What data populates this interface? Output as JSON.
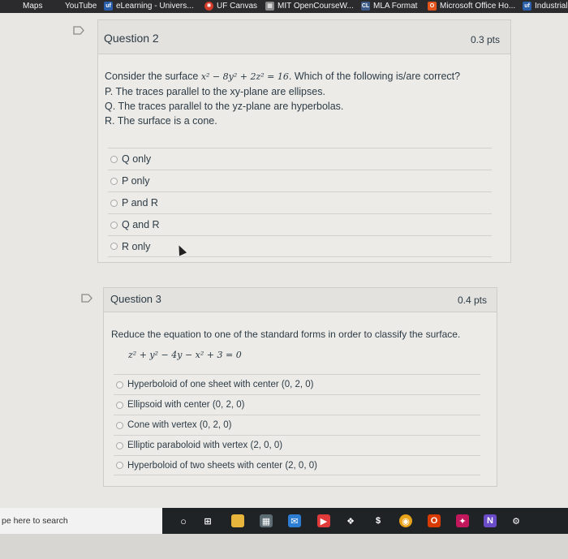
{
  "bookmarks": [
    {
      "label": "Maps",
      "icon": "maps-icon"
    },
    {
      "label": "YouTube",
      "icon": "youtube-icon"
    },
    {
      "label": "eLearning - Univers...",
      "icon": "uf-icon"
    },
    {
      "label": "UF Canvas",
      "icon": "canvas-icon"
    },
    {
      "label": "MIT OpenCourseW...",
      "icon": "mit-icon"
    },
    {
      "label": "MLA Format",
      "icon": "mla-icon"
    },
    {
      "label": "Microsoft Office Ho...",
      "icon": "office-icon"
    },
    {
      "label": "Industrial",
      "icon": "uf-icon"
    }
  ],
  "question2": {
    "title": "Question 2",
    "points": "0.3 pts",
    "prompt_pre": "Consider the surface ",
    "equation": "x² − 8y² + 2z² = 16",
    "prompt_post": ". Which of the following is/are correct?",
    "statements": [
      "P. The traces parallel to the xy-plane are ellipses.",
      "Q. The traces parallel to the yz-plane are hyperbolas.",
      "R. The surface is a cone."
    ],
    "answers": [
      "Q only",
      "P only",
      "P and R",
      "Q and R",
      "R only"
    ]
  },
  "question3": {
    "title": "Question 3",
    "points": "0.4 pts",
    "prompt": "Reduce the equation to one of the standard forms in order to classify the surface.",
    "equation": "z² + y² − 4y − x² + 3 = 0",
    "answers": [
      "Hyperboloid of one sheet with center (0, 2, 0)",
      "Ellipsoid with center (0, 2, 0)",
      "Cone with vertex (0, 2, 0)",
      "Elliptic paraboloid with vertex (2, 0, 0)",
      "Hyperboloid of two sheets with center (2, 0, 0)"
    ]
  },
  "taskbar": {
    "search_text": "pe here to search"
  }
}
